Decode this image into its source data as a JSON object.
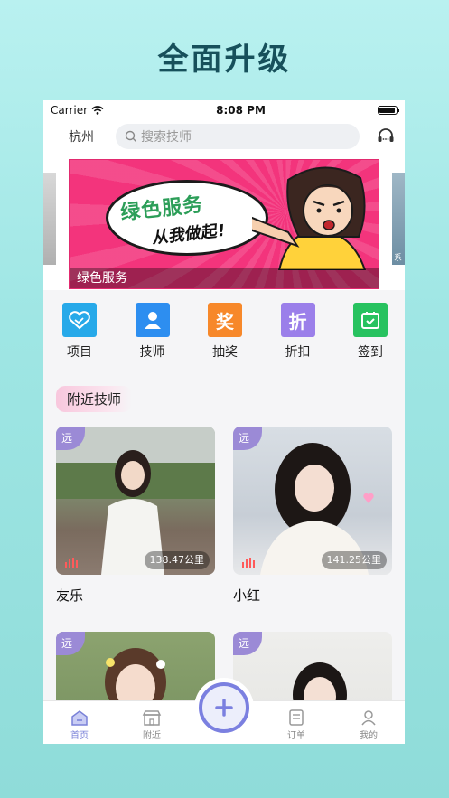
{
  "promo_headline": "全面升级",
  "status_bar": {
    "carrier": "Carrier",
    "time": "8:08 PM"
  },
  "top_bar": {
    "city": "杭州",
    "search_placeholder": "搜索技师"
  },
  "banner": {
    "title": "绿色服务",
    "slogan": "从我做起!",
    "caption": "绿色服务",
    "next_preview": "系"
  },
  "categories": [
    {
      "label": "项目",
      "icon": "handshake-icon",
      "color": "#27a9e9"
    },
    {
      "label": "技师",
      "icon": "person-icon",
      "color": "#2d8ef0"
    },
    {
      "label": "抽奖",
      "icon": "prize-icon",
      "glyph": "奖",
      "color": "#f7882a"
    },
    {
      "label": "折扣",
      "icon": "discount-icon",
      "glyph": "折",
      "color": "#9b7fea"
    },
    {
      "label": "签到",
      "icon": "checkin-calendar-icon",
      "color": "#27c25f"
    }
  ],
  "section": {
    "title": "附近技师"
  },
  "technicians": [
    {
      "name": "友乐",
      "badge": "远",
      "distance": "138.47公里"
    },
    {
      "name": "小红",
      "badge": "远",
      "distance": "141.25公里"
    },
    {
      "name": "",
      "badge": "远",
      "distance": ""
    },
    {
      "name": "",
      "badge": "远",
      "distance": ""
    }
  ],
  "tab_bar": {
    "home": "首页",
    "nearby": "附近",
    "orders": "订单",
    "mine": "我的"
  },
  "colors": {
    "accent": "#7b80e0",
    "badge": "#9b8ad6",
    "banner": "#f3347c"
  }
}
